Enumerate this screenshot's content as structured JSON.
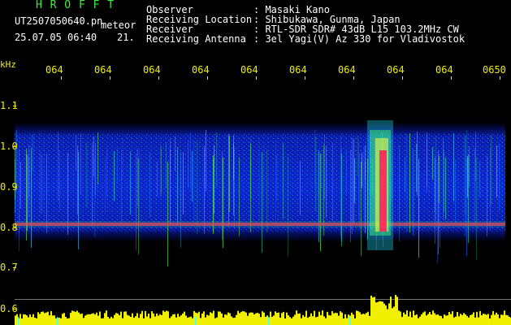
{
  "header": {
    "program": "H R O F F T",
    "filename": "UT2507050640.pn",
    "type_label": "meteor",
    "datetime": "25.07.05 06:40",
    "counter": "21.",
    "info_labels": [
      "Observer",
      "Receiving Location",
      "Receiver",
      "Receiving Antenna"
    ],
    "info_values": [
      ": Masaki Kano",
      ": Shibukawa, Gunma, Japan",
      ": RTL-SDR SDR# 43dB L15 103.2MHz CW",
      ": 3el Yagi(V) Az 330 for Vladivostok"
    ]
  },
  "axes": {
    "unit_label": "kHz",
    "y_ticks": [
      "1.1",
      "1.0",
      "0.9",
      "0.8",
      "0.7",
      "0.6"
    ],
    "x_ticks": [
      "064",
      "064",
      "064",
      "064",
      "064",
      "064",
      "064",
      "064",
      "064",
      "0650"
    ]
  },
  "colors": {
    "header_label": "#ffffff",
    "program_name": "#3cf03c",
    "axis_text": "#f0f000",
    "background": "#000000",
    "echo_core": "#ff2060",
    "noise_low": "#0a20c8",
    "amplitude_trace": "#f0f000"
  },
  "chart_data": {
    "type": "heatmap",
    "xlabel": "",
    "ylabel": "kHz",
    "ylim": [
      0.6,
      1.15
    ],
    "carrier_khz": 0.8,
    "meteor_echo": {
      "x_tick": "064",
      "freq_range_khz": [
        0.78,
        1.08
      ]
    }
  }
}
